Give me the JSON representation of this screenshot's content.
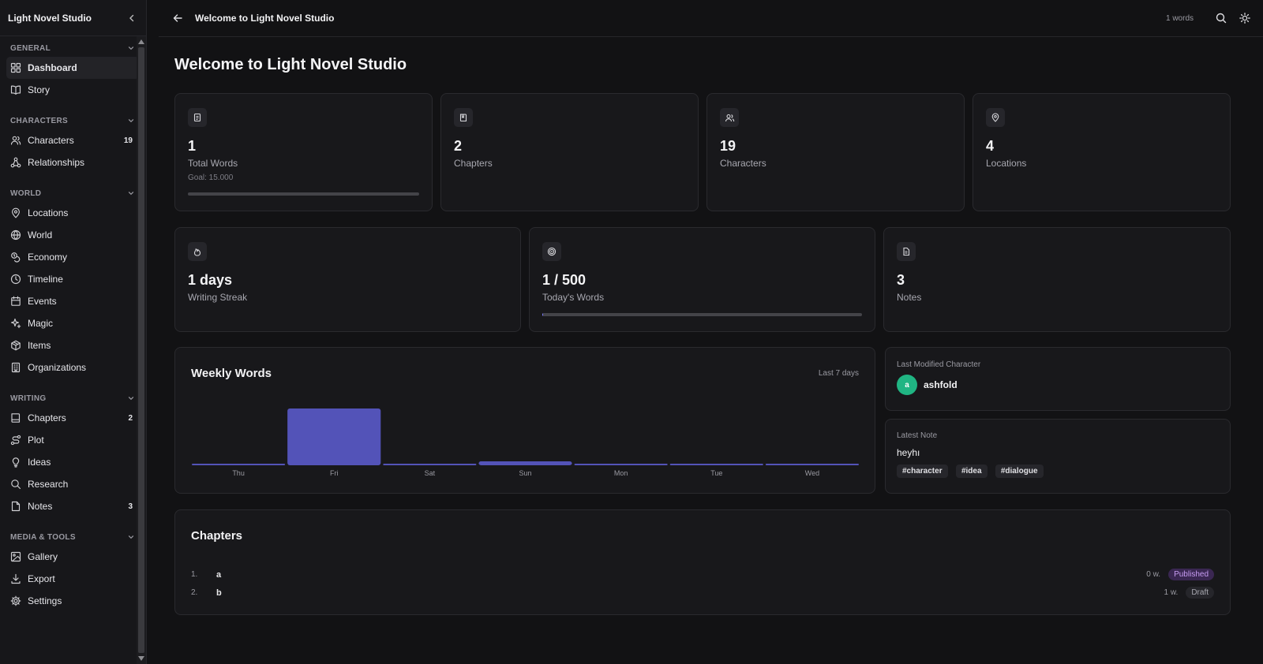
{
  "app": {
    "name": "Light Novel Studio"
  },
  "topbar": {
    "title": "Welcome to Light Novel Studio",
    "word_count": "1 words"
  },
  "sidebar": {
    "sections": [
      {
        "title": "GENERAL",
        "items": [
          {
            "label": "Dashboard",
            "icon": "dashboard-icon",
            "active": true,
            "count": ""
          },
          {
            "label": "Story",
            "icon": "book-icon",
            "count": ""
          }
        ]
      },
      {
        "title": "CHARACTERS",
        "items": [
          {
            "label": "Characters",
            "icon": "users-icon",
            "count": "19"
          },
          {
            "label": "Relationships",
            "icon": "network-icon",
            "count": ""
          }
        ]
      },
      {
        "title": "WORLD",
        "items": [
          {
            "label": "Locations",
            "icon": "map-pin-icon",
            "count": ""
          },
          {
            "label": "World",
            "icon": "globe-icon",
            "count": ""
          },
          {
            "label": "Economy",
            "icon": "coins-icon",
            "count": ""
          },
          {
            "label": "Timeline",
            "icon": "clock-icon",
            "count": ""
          },
          {
            "label": "Events",
            "icon": "calendar-icon",
            "count": ""
          },
          {
            "label": "Magic",
            "icon": "sparkles-icon",
            "count": ""
          },
          {
            "label": "Items",
            "icon": "package-icon",
            "count": ""
          },
          {
            "label": "Organizations",
            "icon": "building-icon",
            "count": ""
          }
        ]
      },
      {
        "title": "WRITING",
        "items": [
          {
            "label": "Chapters",
            "icon": "book-open-icon",
            "count": "2"
          },
          {
            "label": "Plot",
            "icon": "route-icon",
            "count": ""
          },
          {
            "label": "Ideas",
            "icon": "lightbulb-icon",
            "count": ""
          },
          {
            "label": "Research",
            "icon": "search-icon",
            "count": ""
          },
          {
            "label": "Notes",
            "icon": "sticky-note-icon",
            "count": "3"
          }
        ]
      },
      {
        "title": "MEDIA & TOOLS",
        "items": [
          {
            "label": "Gallery",
            "icon": "image-icon",
            "count": ""
          },
          {
            "label": "Export",
            "icon": "download-icon",
            "count": ""
          },
          {
            "label": "Settings",
            "icon": "gear-icon",
            "count": ""
          }
        ]
      }
    ]
  },
  "main": {
    "heading": "Welcome to Light Novel Studio",
    "stats_top": [
      {
        "value": "1",
        "label": "Total Words",
        "sub": "Goal: 15.000",
        "progress": 0.0001,
        "icon": "document-icon"
      },
      {
        "value": "2",
        "label": "Chapters",
        "icon": "book-icon"
      },
      {
        "value": "19",
        "label": "Characters",
        "icon": "users-icon"
      },
      {
        "value": "4",
        "label": "Locations",
        "icon": "map-pin-icon"
      }
    ],
    "stats_mid": [
      {
        "value": "1 days",
        "label": "Writing Streak",
        "icon": "flame-icon"
      },
      {
        "value": "1 / 500",
        "label": "Today's Words",
        "progress": 0.002,
        "icon": "target-icon"
      },
      {
        "value": "3",
        "label": "Notes",
        "icon": "notes-icon"
      }
    ],
    "weekly": {
      "title": "Weekly Words",
      "range": "Last 7 days"
    },
    "last_character": {
      "label": "Last Modified Character",
      "avatar_letter": "a",
      "name": "ashfold"
    },
    "latest_note": {
      "label": "Latest Note",
      "text": "heyhı",
      "tags": [
        "#character",
        "#idea",
        "#dialogue"
      ]
    },
    "chapters": {
      "title": "Chapters",
      "rows": [
        {
          "num": "1.",
          "name": "a",
          "words": "0 w.",
          "status": "Published"
        },
        {
          "num": "2.",
          "name": "b",
          "words": "1 w.",
          "status": "Draft"
        }
      ]
    }
  },
  "chart_data": {
    "type": "bar",
    "title": "Weekly Words",
    "categories": [
      "Thu",
      "Fri",
      "Sat",
      "Sun",
      "Mon",
      "Tue",
      "Wed"
    ],
    "values": [
      0,
      1,
      0,
      0.07,
      0,
      0,
      0
    ],
    "color": "#5353b8"
  }
}
